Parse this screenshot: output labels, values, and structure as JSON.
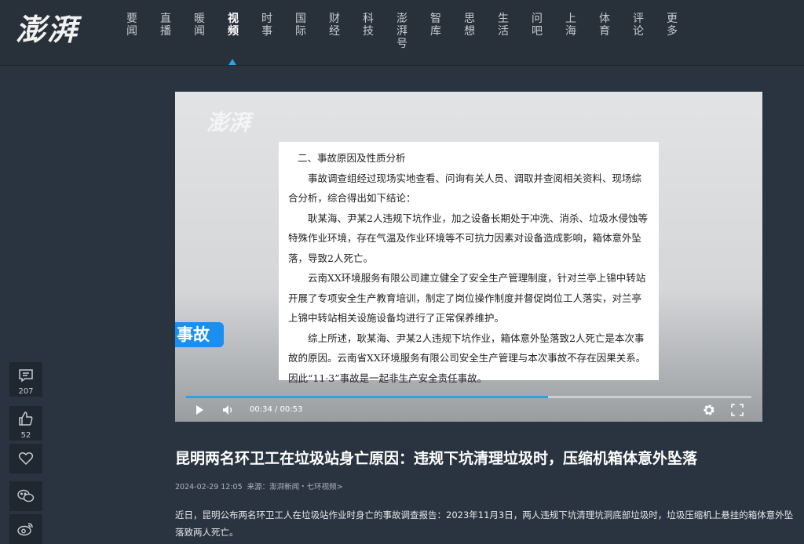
{
  "header": {
    "logo": "澎湃",
    "nav": [
      {
        "label": "要闻"
      },
      {
        "label": "直播"
      },
      {
        "label": "暖闻"
      },
      {
        "label": "视频",
        "active": true
      },
      {
        "label": "时事"
      },
      {
        "label": "国际"
      },
      {
        "label": "财经"
      },
      {
        "label": "科技"
      },
      {
        "label": "澎湃号"
      },
      {
        "label": "智库"
      },
      {
        "label": "思想"
      },
      {
        "label": "生活"
      },
      {
        "label": "问吧"
      },
      {
        "label": "上海"
      },
      {
        "label": "体育"
      },
      {
        "label": "评论"
      },
      {
        "label": "更多"
      }
    ],
    "accent_color": "#29a3e6"
  },
  "video": {
    "watermark": "澎湃",
    "badge": "事故",
    "doc_lines": [
      "二、事故原因及性质分析",
      "事故调查组经过现场实地查看、问询有关人员、调取并查阅相关资料、现场综合分析，综合得出如下结论：",
      "耿某海、尹某2人违规下坑作业，加之设备长期处于冲洗、消杀、垃圾水侵蚀等特殊作业环境，存在气温及作业环境等不可抗力因素对设备造成影响，箱体意外坠落，导致2人死亡。",
      "云南XX环境服务有限公司建立健全了安全生产管理制度，针对兰亭上锦中转站开展了专项安全生产教育培训，制定了岗位操作制度并督促岗位工人落实，对兰亭上锦中转站相关设施设备均进行了正常保养维护。",
      "综上所述，耿某海、尹某2人违规下坑作业，箱体意外坠落致2人死亡是本次事故的原因。云南省XX环境服务有限公司安全生产管理与本次事故不存在因果关系。因此“11·3”事故是一起非生产安全责任事故。"
    ],
    "current_time": "00:34",
    "duration": "00:53",
    "time_readout": "00:34 / 00:53",
    "progress_fraction": 0.64,
    "icons": {
      "play": "play-icon",
      "volume": "volume-icon",
      "settings": "gear-icon",
      "fullscreen": "fullscreen-icon"
    }
  },
  "sidebar": {
    "comment_count": "207",
    "like_count": "52"
  },
  "article": {
    "title": "昆明两名环卫工在垃圾站身亡原因：违规下坑清理垃圾时，压缩机箱体意外坠落",
    "date": "2024-02-29 12:05",
    "source_label": "来源：",
    "source": "澎湃新闻・七环视频>",
    "summary": "近日，昆明公布两名环卫工人在垃圾站作业时身亡的事故调查报告：2023年11月3日，两人违规下坑清理坑洞底部垃圾时，垃圾压缩机上悬挂的箱体意外坠落致两人死亡。"
  }
}
